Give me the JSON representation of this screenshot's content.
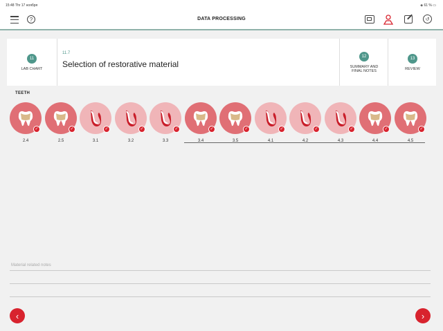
{
  "statusbar": {
    "time": "15:48",
    "date": "Thr 17 ноября",
    "battery": "61 %"
  },
  "header": {
    "title": "DATA PROCESSING"
  },
  "steps": {
    "lab": {
      "num": "11",
      "label": "LAB CHART"
    },
    "current": {
      "code": "11.7",
      "title": "Selection of restorative material"
    },
    "summary": {
      "num": "12",
      "label1": "SUMMARY AND",
      "label2": "FINAL NOTES"
    },
    "review": {
      "num": "13",
      "label": "REVIEW"
    }
  },
  "teeth_label": "TEETH",
  "teeth": [
    {
      "id": "2.4",
      "type": "molar",
      "bg": "#e06f75"
    },
    {
      "id": "2.5",
      "type": "molar",
      "bg": "#e06f75"
    },
    {
      "id": "3.1",
      "type": "incisor",
      "bg": "#f0b5b8"
    },
    {
      "id": "3.2",
      "type": "incisor",
      "bg": "#f0b5b8"
    },
    {
      "id": "3.3",
      "type": "incisor",
      "bg": "#f0b5b8"
    },
    {
      "id": "3.4",
      "type": "molar",
      "bg": "#e06f75"
    },
    {
      "id": "3.5",
      "type": "molar",
      "bg": "#e06f75"
    },
    {
      "id": "4.1",
      "type": "incisor",
      "bg": "#f0b5b8"
    },
    {
      "id": "4.2",
      "type": "incisor",
      "bg": "#f0b5b8"
    },
    {
      "id": "4.3",
      "type": "incisor",
      "bg": "#f0b5b8"
    },
    {
      "id": "4.4",
      "type": "molar",
      "bg": "#e06f75"
    },
    {
      "id": "4.5",
      "type": "molar",
      "bg": "#e06f75"
    }
  ],
  "notes_placeholder": "Material related notes",
  "colors": {
    "accent": "#d8232e",
    "teal": "#4f978b"
  }
}
